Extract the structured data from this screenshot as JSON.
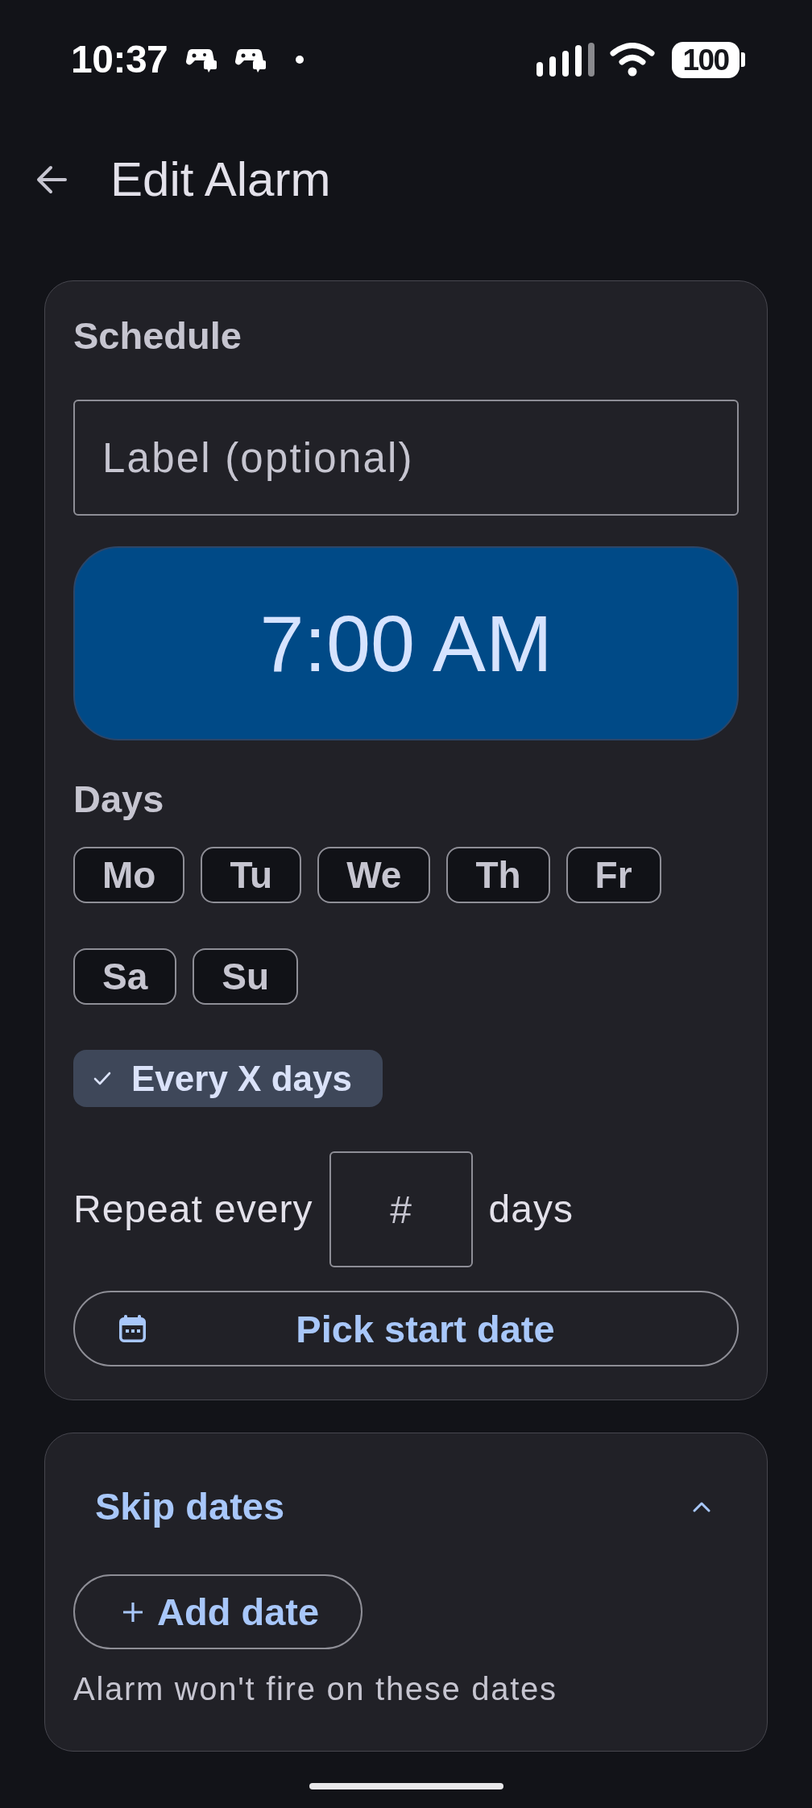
{
  "status_bar": {
    "time": "10:37",
    "battery": "100"
  },
  "header": {
    "title": "Edit Alarm"
  },
  "schedule": {
    "title": "Schedule",
    "label_field": {
      "placeholder": "Label (optional)"
    },
    "time_button": "7:00 AM",
    "days_title": "Days",
    "days": [
      {
        "label": "Mo",
        "selected": false
      },
      {
        "label": "Tu",
        "selected": false
      },
      {
        "label": "We",
        "selected": false
      },
      {
        "label": "Th",
        "selected": false
      },
      {
        "label": "Fr",
        "selected": false
      },
      {
        "label": "Sa",
        "selected": false
      },
      {
        "label": "Su",
        "selected": false
      }
    ],
    "mode_chip": {
      "label": "Every X days",
      "selected": true
    },
    "repeat": {
      "prefix": "Repeat every",
      "field": {
        "placeholder": "#"
      },
      "suffix": "days"
    },
    "start_date_button": "Pick start date"
  },
  "skip_dates": {
    "title": "Skip dates",
    "expanded": true,
    "add_button": "Add date",
    "hint": "Alarm won't fire on these dates"
  }
}
